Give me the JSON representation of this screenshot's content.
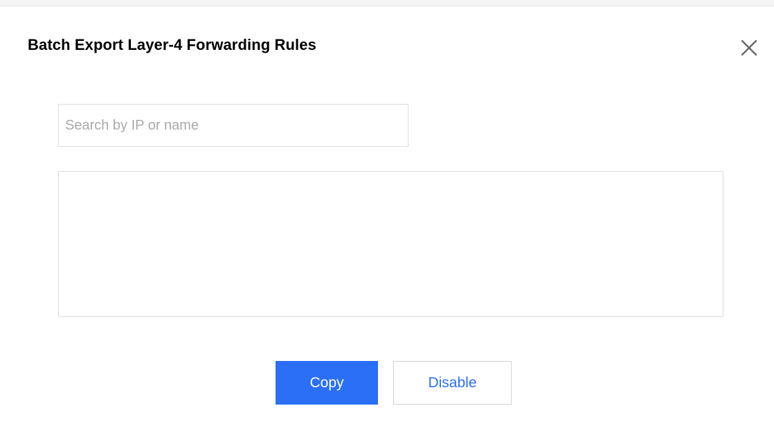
{
  "dialog": {
    "title": "Batch Export Layer-4 Forwarding Rules",
    "close_icon": "close-icon"
  },
  "search": {
    "placeholder": "Search by IP or name",
    "value": ""
  },
  "result": {
    "value": ""
  },
  "actions": {
    "copy_label": "Copy",
    "disable_label": "Disable"
  },
  "colors": {
    "primary": "#2a6ff5",
    "border": "#dcdcdc",
    "title": "#000000",
    "placeholder": "#a9a9a9",
    "close_icon": "#666666"
  }
}
